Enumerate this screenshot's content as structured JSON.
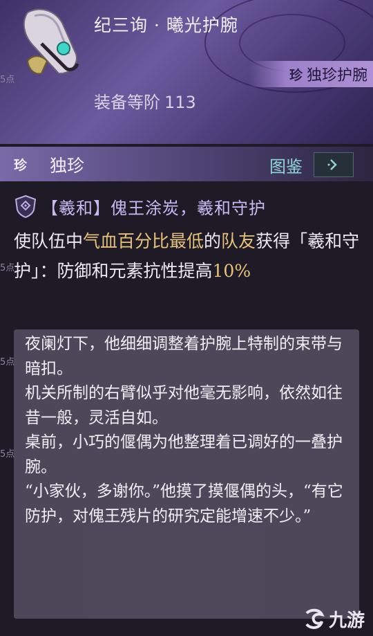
{
  "item": {
    "title": "纪三询 · 曦光护腕",
    "rarity_mark": "珍",
    "rarity_label": "独珍护腕",
    "gear_level_label": "装备等阶",
    "gear_level_value": "113",
    "icon": "gauntlet-icon"
  },
  "rarity_bar": {
    "mark": "珍",
    "label": "独珍",
    "codex_label": "图鉴",
    "codex_icon": "chevron-right-icon"
  },
  "skill": {
    "icon": "shield-icon",
    "title": "【羲和】傀王涂炭，羲和守护"
  },
  "description": {
    "part1": "使队伍中",
    "highlight1": "气血百分比最低",
    "part2": "的",
    "highlight2": "队友",
    "part3": "获得「羲和守护」：防御和元素抗性提高",
    "highlight3": "10%"
  },
  "side_tags": [
    "5点",
    "5点",
    "5点",
    "5点"
  ],
  "lore": [
    "夜阑灯下，他细细调整着护腕上特制的束带与暗扣。",
    "机关所制的右臂似乎对他毫无影响，依然如往昔一般，灵活自如。",
    "桌前，小巧的偃偶为他整理着已调好的一叠护腕。",
    "“小家伙，多谢你。”他摸了摸偃偶的头，“有它防护，对傀王残片的研究定能增速不少。”"
  ],
  "watermark": {
    "text": "九游",
    "icon": "jiuyou-logo-icon"
  },
  "colors": {
    "header": "#5a4a8c",
    "gold": "#e7c27a",
    "teal": "#8fd7d7",
    "skill_text": "#c9b9f2"
  }
}
